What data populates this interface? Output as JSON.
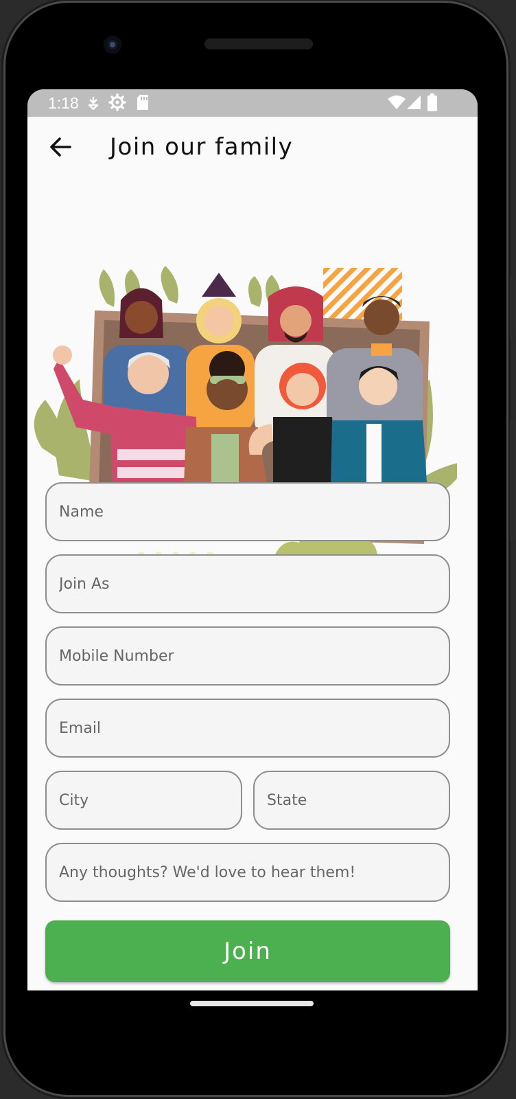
{
  "status_bar": {
    "time": "1:18",
    "icons": [
      "location-icon",
      "settings-icon",
      "sd-card-icon",
      "wifi-icon",
      "signal-icon",
      "battery-icon"
    ]
  },
  "app_bar": {
    "title": "Join our family",
    "back_icon": "arrow-back-icon"
  },
  "illustration": {
    "description": "group-of-people-in-frame",
    "colors": {
      "frame": "#b38b74",
      "leaf": "#a9b36b",
      "stripes": "#f6a442"
    }
  },
  "form": {
    "name": {
      "placeholder": "Name",
      "value": ""
    },
    "join_as": {
      "placeholder": "Join As",
      "value": ""
    },
    "mobile": {
      "placeholder": "Mobile Number",
      "value": ""
    },
    "email": {
      "placeholder": "Email",
      "value": ""
    },
    "city": {
      "placeholder": "City",
      "value": ""
    },
    "state": {
      "placeholder": "State",
      "value": ""
    },
    "thoughts": {
      "placeholder": "Any thoughts? We'd love to hear them!",
      "value": ""
    },
    "join_label": "Join"
  },
  "colors": {
    "accent": "#4caf50",
    "status_bar": "#bdbdbd",
    "background": "#fafafa"
  }
}
